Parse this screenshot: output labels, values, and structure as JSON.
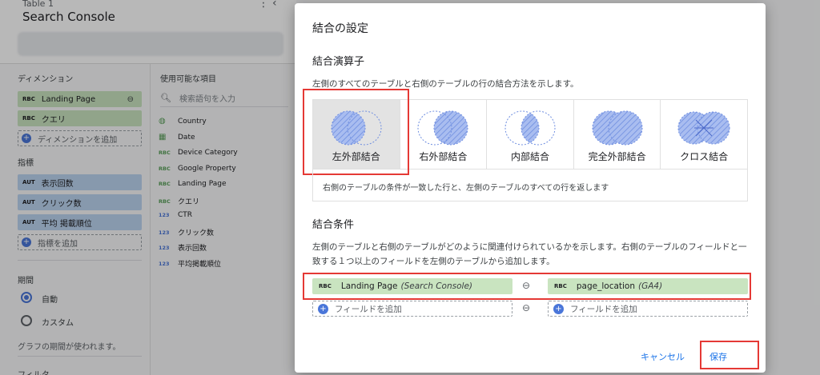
{
  "background": {
    "table_label": "Table 1",
    "data_source": "Search Console",
    "dimensions_title": "ディメンション",
    "dimensions": [
      {
        "type": "RBC",
        "label": "Landing Page"
      },
      {
        "type": "RBC",
        "label": "クエリ"
      }
    ],
    "add_dimension": "ディメンションを追加",
    "metrics_title": "指標",
    "metrics": [
      {
        "type": "AUT",
        "label": "表示回数"
      },
      {
        "type": "AUT",
        "label": "クリック数"
      },
      {
        "type": "AUT",
        "label": "平均 掲載順位"
      }
    ],
    "add_metric": "指標を追加",
    "period_title": "期間",
    "period_auto": "自動",
    "period_custom": "カスタム",
    "period_note": "グラフの期間が使われます。",
    "filter_title": "フィルタ",
    "available_title": "使用可能な項目",
    "search_placeholder": "検索語句を入力",
    "fields": [
      {
        "type": "geo",
        "label": "Country"
      },
      {
        "type": "date",
        "label": "Date"
      },
      {
        "type": "RBC",
        "label": "Device Category"
      },
      {
        "type": "RBC",
        "label": "Google Property"
      },
      {
        "type": "RBC",
        "label": "Landing Page"
      },
      {
        "type": "RBC",
        "label": "クエリ"
      },
      {
        "type": "123",
        "label": "CTR"
      },
      {
        "type": "123",
        "label": "クリック数"
      },
      {
        "type": "123",
        "label": "表示回数"
      },
      {
        "type": "123",
        "label": "平均掲載順位"
      }
    ]
  },
  "dialog": {
    "title": "結合の設定",
    "operator_heading": "結合演算子",
    "operator_desc": "左側のすべてのテーブルと右側のテーブルの行の結合方法を示します。",
    "operators": [
      {
        "key": "left",
        "label": "左外部結合",
        "selected": true
      },
      {
        "key": "right",
        "label": "右外部結合",
        "selected": false
      },
      {
        "key": "inner",
        "label": "内部結合",
        "selected": false
      },
      {
        "key": "full",
        "label": "完全外部結合",
        "selected": false
      },
      {
        "key": "cross",
        "label": "クロス結合",
        "selected": false
      }
    ],
    "operator_selected_desc": "右側のテーブルの条件が一致した行と、左側のテーブルのすべての行を返します",
    "condition_heading": "結合条件",
    "condition_desc": "左側のテーブルと右側のテーブルがどのように関連付けられているかを示します。右側のテーブルのフィールドと一致する１つ以上のフィールドを左側のテーブルから追加します。",
    "left_field": {
      "type": "RBC",
      "name": "Landing Page",
      "source": "(Search Console)"
    },
    "right_field": {
      "type": "RBC",
      "name": "page_location",
      "source": "(GA4)"
    },
    "add_field": "フィールドを追加",
    "cancel_label": "キャンセル",
    "save_label": "保存"
  },
  "colors": {
    "accent": "#1a73e8",
    "highlight_red": "#e53935",
    "dimension_green": "#c9e4c0",
    "metric_blue": "#bcd4f0",
    "venn_fill": "#8fa8e6"
  }
}
